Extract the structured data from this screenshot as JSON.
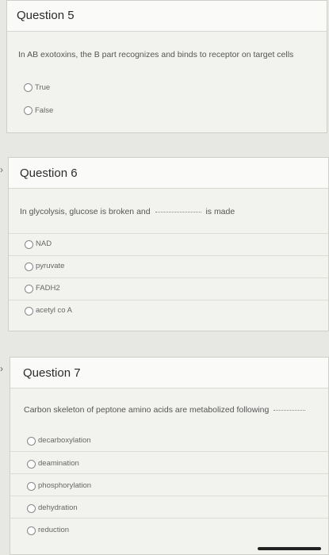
{
  "q5": {
    "title": "Question 5",
    "prompt": "In AB exotoxins, the B part recognizes and binds to receptor on target cells",
    "options": [
      "True",
      "False"
    ]
  },
  "q6": {
    "title": "Question 6",
    "prompt_before": "In glycolysis, glucose is broken and",
    "prompt_after": "is made",
    "options": [
      "NAD",
      "pyruvate",
      "FADH2",
      "acetyl co A"
    ]
  },
  "q7": {
    "title": "Question 7",
    "prompt": "Carbon skeleton of peptone amino acids are metabolized following",
    "options": [
      "decarboxylation",
      "deamination",
      "phosphorylation",
      "dehydration",
      "reduction"
    ]
  }
}
